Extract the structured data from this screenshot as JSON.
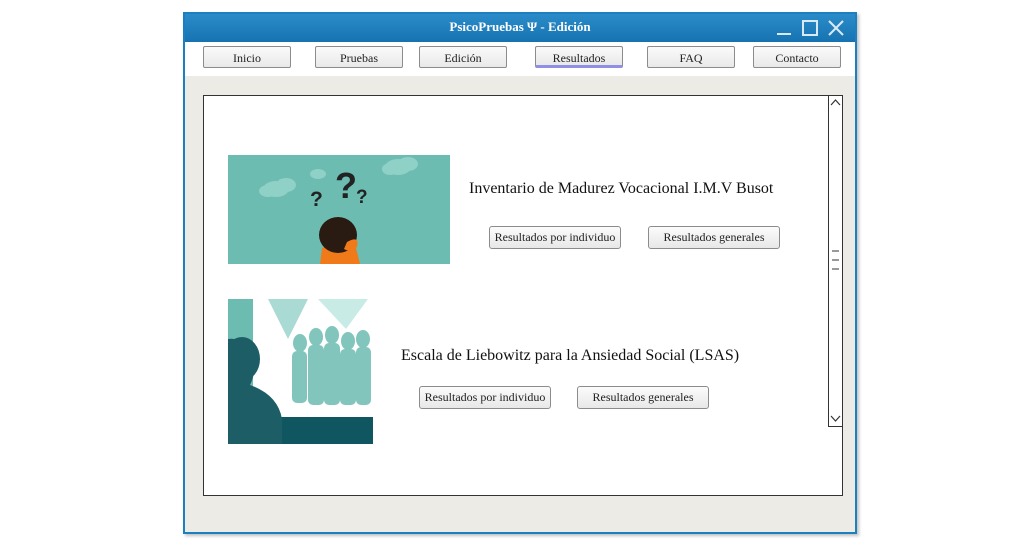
{
  "window": {
    "title": "PsicoPruebas Ψ - Edición"
  },
  "nav": [
    {
      "label": "Inicio"
    },
    {
      "label": "Pruebas"
    },
    {
      "label": "Edición"
    },
    {
      "label": "Resultados"
    },
    {
      "label": "FAQ"
    },
    {
      "label": "Contacto"
    }
  ],
  "active_nav": "Resultados",
  "tests": [
    {
      "title": "Inventario de Madurez Vocacional I.M.V Busot",
      "individual_button": "Resultados por individuo",
      "general_button": "Resultados generales"
    },
    {
      "title": "Escala de Liebowitz para la Ansiedad Social (LSAS)",
      "individual_button": "Resultados por individuo",
      "general_button": "Resultados generales"
    }
  ],
  "colors": {
    "titlebar": "#1673b1",
    "accent_teal": "#6cbcb2",
    "dark_teal": "#0f5661",
    "orange": "#f07a1a"
  }
}
